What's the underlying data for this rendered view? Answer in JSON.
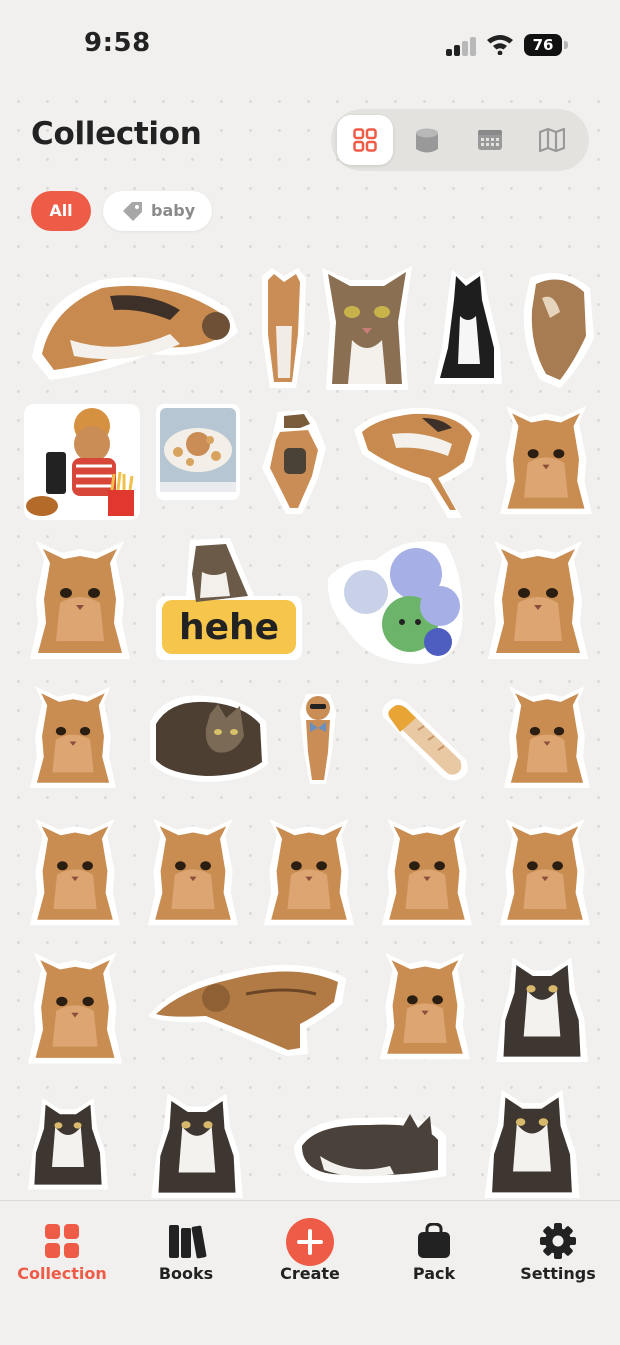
{
  "status_bar": {
    "time": "9:58",
    "battery": "76"
  },
  "header": {
    "title": "Collection",
    "view_modes": [
      "grid-icon",
      "cylinder-icon",
      "calendar-icon",
      "map-icon"
    ],
    "active_view": "grid"
  },
  "filters": [
    {
      "label": "All",
      "active": true
    },
    {
      "label": "baby",
      "icon": "tag-icon",
      "active": false
    }
  ],
  "stickers": [
    {
      "name": "calico-cat-lying",
      "sticker_text": ""
    },
    {
      "name": "cat-standing-tall"
    },
    {
      "name": "tabby-cat-face"
    },
    {
      "name": "tuxedo-cat-sitting"
    },
    {
      "name": "cat-curled-dancing"
    },
    {
      "name": "cat-fastfood-meal"
    },
    {
      "name": "cat-in-cereal-bowl"
    },
    {
      "name": "cat-with-hat-backpack"
    },
    {
      "name": "calico-cat-falling"
    },
    {
      "name": "fluffy-orange-kitten"
    },
    {
      "name": "fluffy-orange-kitten"
    },
    {
      "name": "cat-hehe-sign",
      "sticker_text": "hehe"
    },
    {
      "name": "plush-toys-pile"
    },
    {
      "name": "fluffy-orange-kitten"
    },
    {
      "name": "fluffy-orange-kitten"
    },
    {
      "name": "tabby-cat-loaf"
    },
    {
      "name": "cat-in-bowtie"
    },
    {
      "name": "bread-roll"
    },
    {
      "name": "fluffy-orange-kitten"
    },
    {
      "name": "fluffy-orange-kitten"
    },
    {
      "name": "fluffy-orange-kitten"
    },
    {
      "name": "fluffy-orange-kitten"
    },
    {
      "name": "fluffy-orange-kitten"
    },
    {
      "name": "fluffy-orange-kitten"
    },
    {
      "name": "fluffy-orange-kitten"
    },
    {
      "name": "orange-cat-stretched"
    },
    {
      "name": "fluffy-orange-kitten"
    },
    {
      "name": "tabby-white-cat-sitting"
    },
    {
      "name": "tabby-white-cat-sitting"
    },
    {
      "name": "tabby-white-cat-lying"
    },
    {
      "name": "tabby-white-cat-lying"
    },
    {
      "name": "tabby-white-cat-lying"
    }
  ],
  "tab_bar": [
    {
      "label": "Collection",
      "icon": "collection-icon",
      "active": true
    },
    {
      "label": "Books",
      "icon": "books-icon",
      "active": false
    },
    {
      "label": "Create",
      "icon": "plus-circle-icon",
      "active": false
    },
    {
      "label": "Pack",
      "icon": "bag-icon",
      "active": false
    },
    {
      "label": "Settings",
      "icon": "gear-icon",
      "active": false
    }
  ],
  "colors": {
    "accent": "#ee5c48",
    "background": "#f1f0ee",
    "text": "#222222"
  }
}
